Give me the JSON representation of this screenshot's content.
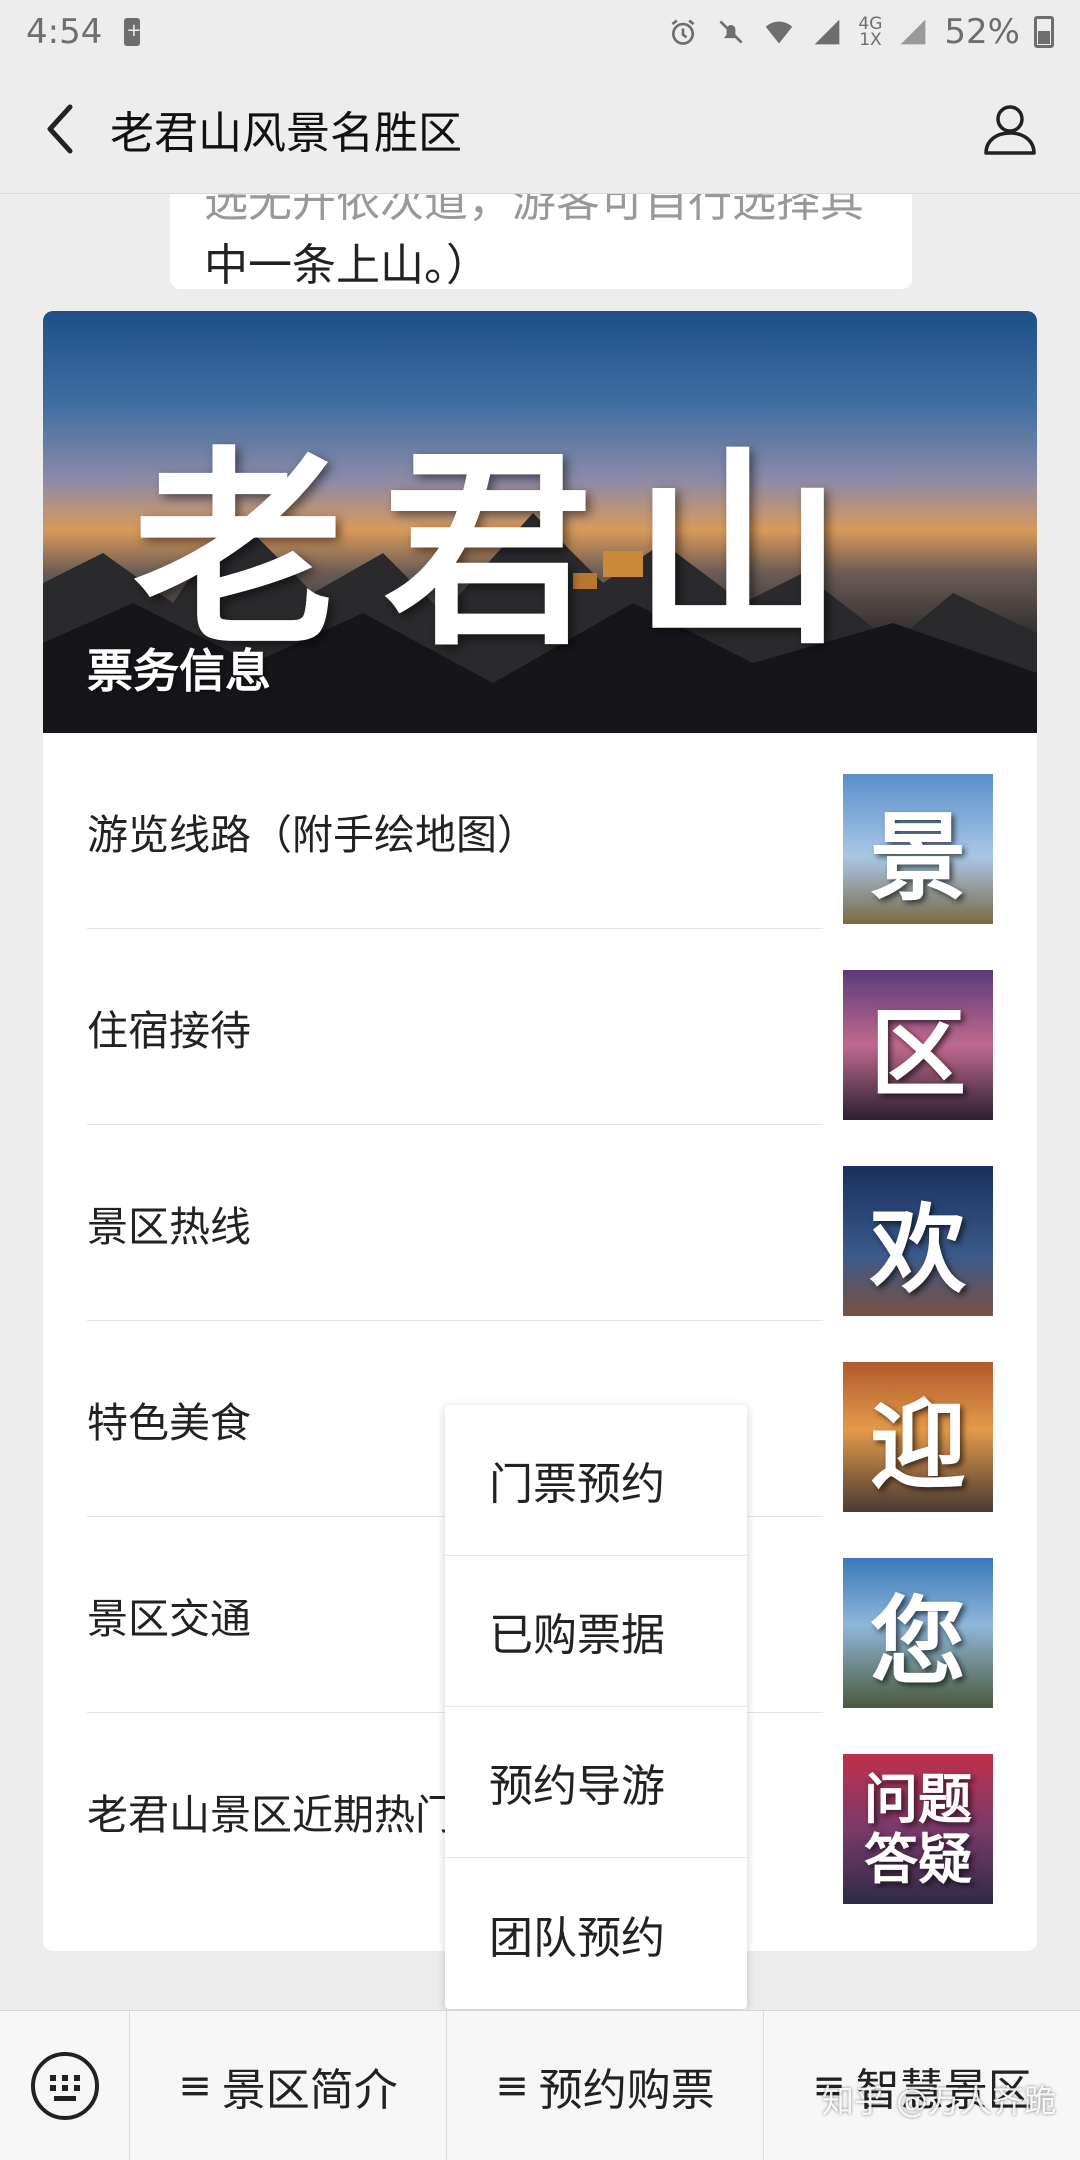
{
  "status_bar": {
    "time": "4:54",
    "network": "4G",
    "network_sub": "1X",
    "battery": "52%"
  },
  "header": {
    "title": "老君山风景名胜区"
  },
  "message": {
    "line1": "选无开依次道，游客可自行选择其",
    "line2": "中一条上山。）"
  },
  "banner": {
    "calligraphy": "老君山",
    "caption": "票务信息"
  },
  "list": {
    "items": [
      {
        "label": "游览线路（附手绘地图）",
        "thumb": "景"
      },
      {
        "label": "住宿接待",
        "thumb": "区"
      },
      {
        "label": "景区热线",
        "thumb": "欢"
      },
      {
        "label": "特色美食",
        "thumb": "迎"
      },
      {
        "label": "景区交通",
        "thumb": "您"
      },
      {
        "label": "老君山景区近期热门",
        "thumb_line1": "问题",
        "thumb_line2": "答疑"
      }
    ]
  },
  "popup_menu": {
    "items": [
      "门票预约",
      "已购票据",
      "预约导游",
      "团队预约"
    ]
  },
  "bottom_menu": {
    "items": [
      "景区简介",
      "预约购票",
      "智慧景区"
    ],
    "menu_glyph": "≡"
  },
  "watermark": "知乎 @万人齐跪"
}
